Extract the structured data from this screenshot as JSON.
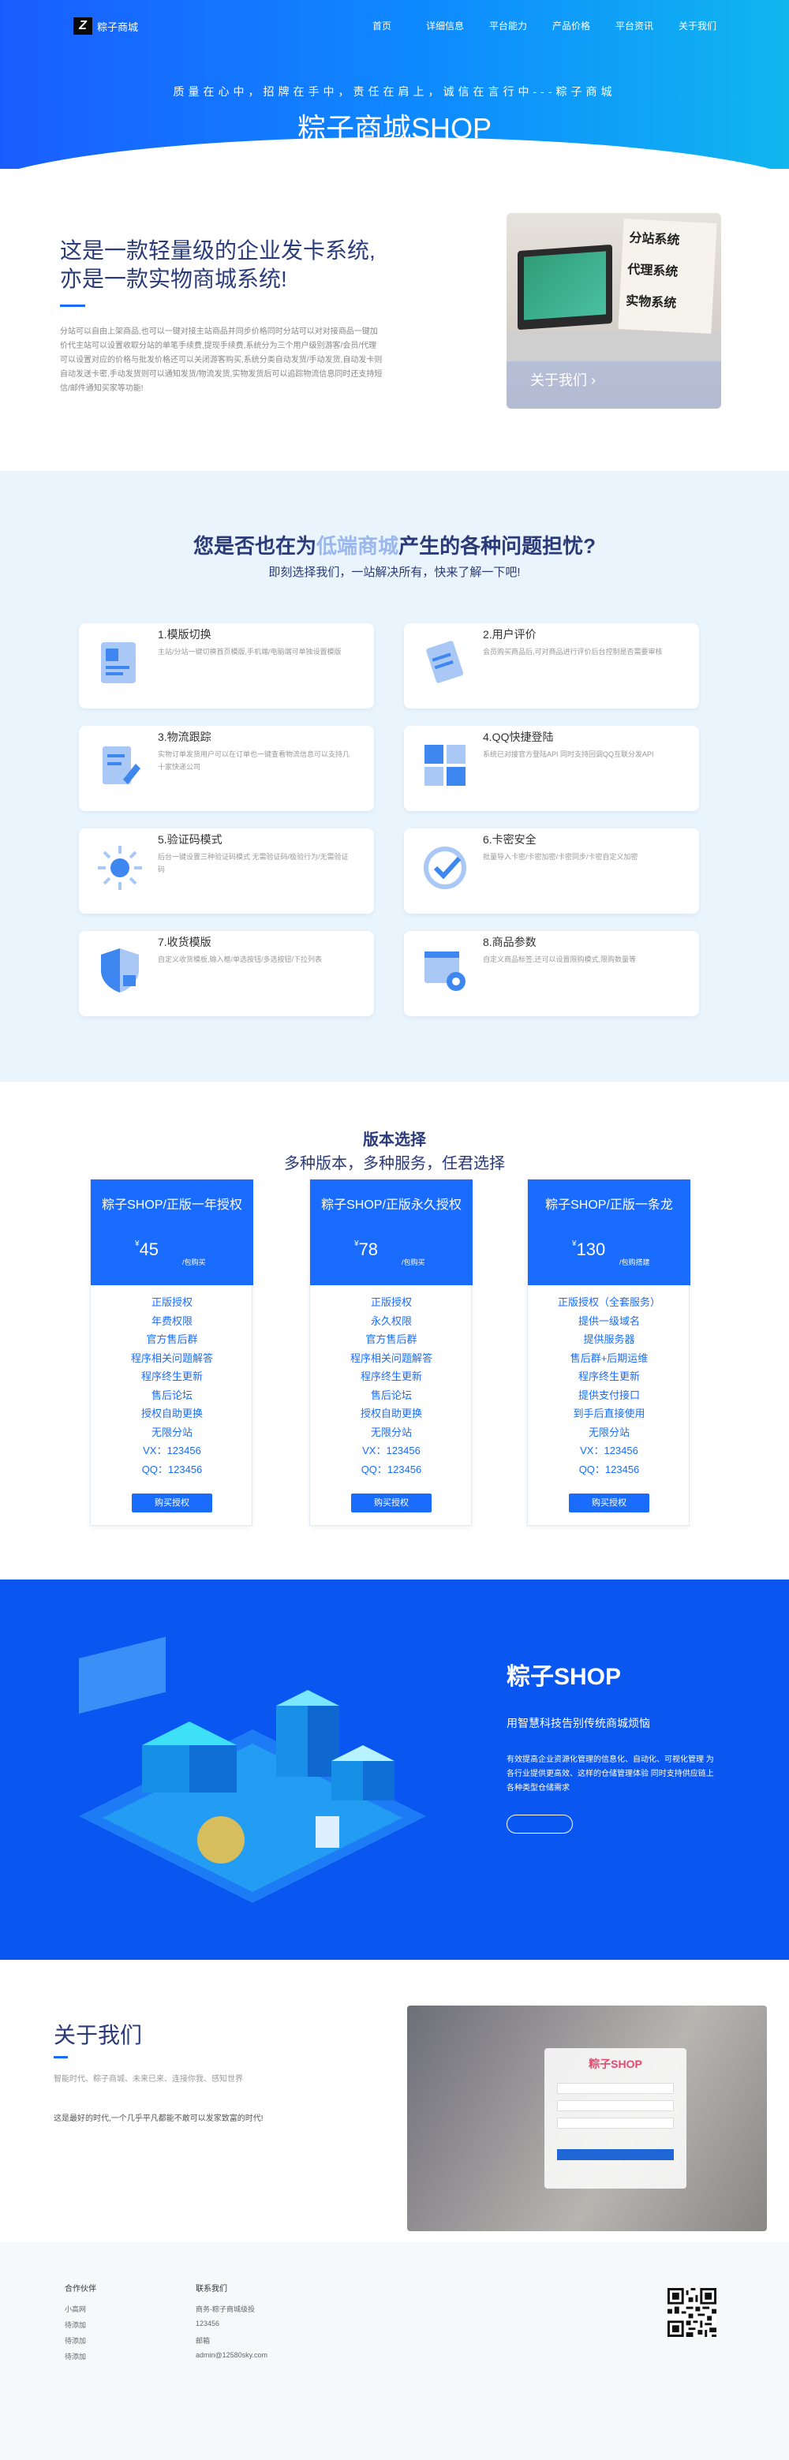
{
  "header": {
    "logo_mark": "Z",
    "logo_text": "粽子商城",
    "nav": [
      "首页",
      "详细信息",
      "平台能力",
      "产品价格",
      "平台资讯",
      "关于我们"
    ],
    "motto": "质量在心中，招牌在手中，责任在肩上，诚信在言行中---粽子商城",
    "brand": "粽子商城SHOP"
  },
  "intro": {
    "title_line1": "这是一款轻量级的企业发卡系统,",
    "title_line2": "亦是一款实物商城系统!",
    "text": "分站可以自由上架商品,也可以一键对接主站商品并同步价格同时分站可以对对接商品一键加价代主站可以设置收取分站的单笔手续费,提现手续费,系统分为三个用户级别游客/会员/代理可以设置对应的价格与批发价格还可以关闭游客购买,系统分类自动发货/手动发货,自动发卡则自动发送卡密,手动发货则可以通知发货/物流发货,实物发货后可以追踪物流信息同时还支持短信/邮件通知买家等功能!",
    "image_notes": [
      "分站系统",
      "代理系统",
      "实物系统"
    ],
    "image_caption": "关于我们 ›"
  },
  "problems": {
    "title_pre": "您是否也在为",
    "title_hl": "低端商城",
    "title_post": "产生的各种问题担忧?",
    "subtitle": "即刻选择我们，一站解决所有，快来了解一下吧!",
    "cards": [
      {
        "title": "1.模版切换",
        "desc": "主站/分站一键切换首页模版,手机端/电脑端可单独设置模版"
      },
      {
        "title": "2.用户评价",
        "desc": "会员购买商品后,可对商品进行评价后台控制是否需要审核"
      },
      {
        "title": "3.物流跟踪",
        "desc": "实物订单发货用户可以在订单也一键查看物流信息可以支持几十家快递公司"
      },
      {
        "title": "4.QQ快捷登陆",
        "desc": "系统已对接官方登陆API 同时支持回调QQ互联分发API"
      },
      {
        "title": "5.验证码模式",
        "desc": "后台一键设置三种验证码模式 无需验证码/极验行为/无需验证码"
      },
      {
        "title": "6.卡密安全",
        "desc": "批量导入卡密/卡密加密/卡密同步/卡密自定义加密"
      },
      {
        "title": "7.收货模版",
        "desc": "自定义收货模板,输入框/单选按钮/多选按钮/下拉列表"
      },
      {
        "title": "8.商品参数",
        "desc": "自定义商品标签,还可以设置限购模式,限购数量等"
      }
    ]
  },
  "versions": {
    "title": "版本选择",
    "subtitle": "多种版本，多种服务，任君选择",
    "plans": [
      {
        "name": "粽子SHOP/正版一年授权",
        "currency": "¥",
        "price": "45",
        "unit": "/包购买",
        "features": [
          "正版授权",
          "年费权限",
          "官方售后群",
          "程序相关问题解答",
          "程序终生更新",
          "售后论坛",
          "授权自助更换",
          "无限分站",
          "VX：123456",
          "QQ：123456"
        ],
        "button": "购买授权"
      },
      {
        "name": "粽子SHOP/正版永久授权",
        "currency": "¥",
        "price": "78",
        "unit": "/包购买",
        "features": [
          "正版授权",
          "永久权限",
          "官方售后群",
          "程序相关问题解答",
          "程序终生更新",
          "售后论坛",
          "授权自助更换",
          "无限分站",
          "VX：123456",
          "QQ：123456"
        ],
        "button": "购买授权"
      },
      {
        "name": "粽子SHOP/正版一条龙",
        "currency": "¥",
        "price": "130",
        "unit": "/包购搭建",
        "features": [
          "正版授权（全套服务）",
          "提供一级域名",
          "提供服务器",
          "售后群+后期运维",
          "程序终生更新",
          "提供支付接口",
          "到手后直接使用",
          "无限分站",
          "VX：123456",
          "QQ：123456"
        ],
        "button": "购买授权"
      }
    ]
  },
  "feature": {
    "title": "粽子SHOP",
    "subtitle": "用智慧科技告别传统商城烦恼",
    "desc": "有效提高企业资源化管理的信息化、自动化、可视化管理 为各行业提供更高效、这样的仓储管理体验 同时支持供应链上各种类型仓储需求"
  },
  "about": {
    "title": "关于我们",
    "tagline": "智能时代、粽子商城、未来已来、连接你我、感知世界",
    "text": "这是最好的时代,一个几乎平凡都能不敢可以发家致富的时代!",
    "form_title": "粽子SHOP"
  },
  "footer": {
    "col1_title": "合作伙伴",
    "col1": [
      "小高网",
      "待添加",
      "待添加",
      "待添加"
    ],
    "col2_title": "联系我们",
    "col2": [
      "商务-粽子商城级投",
      "123456",
      "邮箱",
      "admin@12580sky.com"
    ]
  },
  "colors": {
    "primary": "#1a6cff",
    "dark_text": "#2b3a78",
    "problem_bg": "#e9f4fc",
    "feature_bg": "#0a56f0"
  }
}
